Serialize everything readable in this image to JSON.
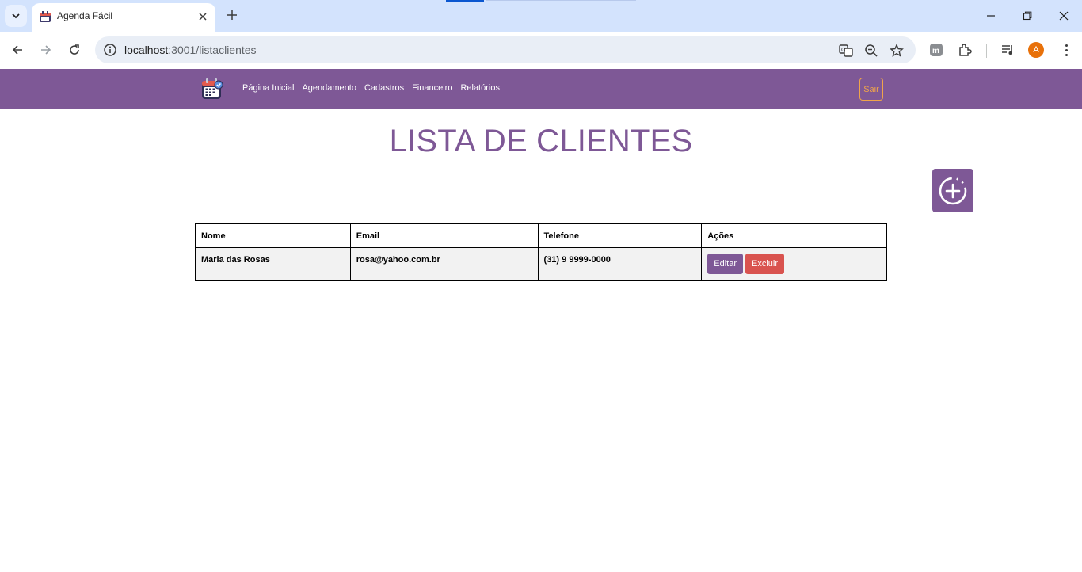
{
  "browser": {
    "tab_title": "Agenda Fácil",
    "url_host": "localhost",
    "url_rest": ":3001/listaclientes",
    "profile_initial": "A"
  },
  "nav": {
    "links": [
      {
        "label": "Página Inicial"
      },
      {
        "label": "Agendamento"
      },
      {
        "label": "Cadastros"
      },
      {
        "label": "Financeiro"
      },
      {
        "label": "Relatórios"
      }
    ],
    "logout_label": "Sair"
  },
  "page": {
    "title": "LISTA DE CLIENTES"
  },
  "table": {
    "headers": [
      "Nome",
      "Email",
      "Telefone",
      "Ações"
    ],
    "rows": [
      {
        "name": "Maria das Rosas",
        "email": "rosa@yahoo.com.br",
        "phone": "(31) 9 9999-0000"
      }
    ],
    "edit_label": "Editar",
    "delete_label": "Excluir"
  },
  "icons": {
    "add": "add-circle-icon",
    "logo": "calendar-logo-icon"
  },
  "colors": {
    "brand": "#7e5896",
    "danger": "#d9534f",
    "accent": "#f0a44b"
  }
}
